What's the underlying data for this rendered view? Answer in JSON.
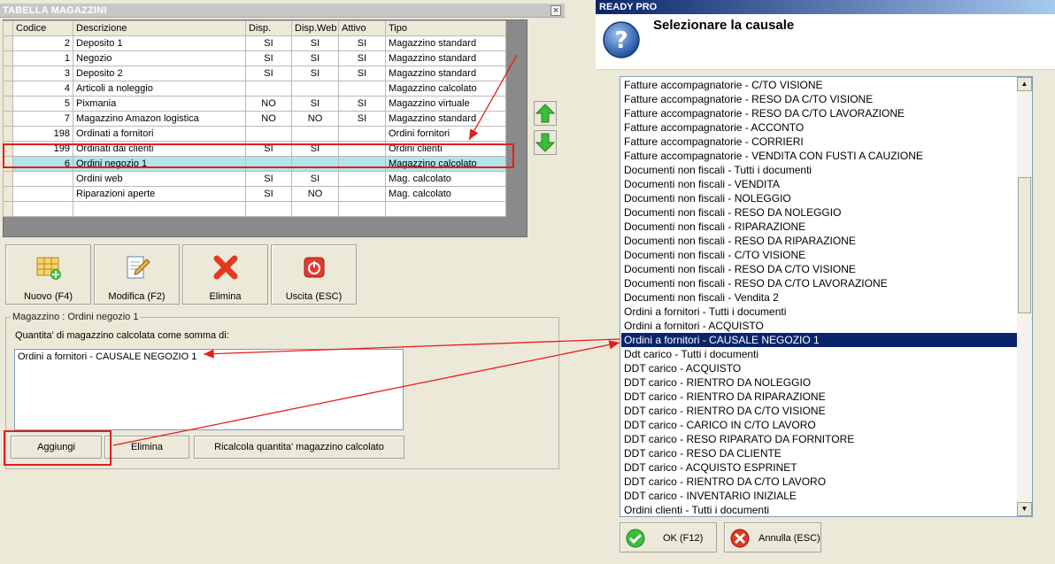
{
  "left_window": {
    "title": "TABELLA MAGAZZINI",
    "close_glyph": "×",
    "columns": [
      "Codice",
      "Descrizione",
      "Disp.",
      "Disp.Web",
      "Attivo",
      "Tipo"
    ],
    "rows": [
      {
        "codice": "2",
        "descrizione": "Deposito 1",
        "disp": "SI",
        "disp_web": "SI",
        "attivo": "SI",
        "tipo": "Magazzino standard"
      },
      {
        "codice": "1",
        "descrizione": "Negozio",
        "disp": "SI",
        "disp_web": "SI",
        "attivo": "SI",
        "tipo": "Magazzino standard"
      },
      {
        "codice": "3",
        "descrizione": "Deposito 2",
        "disp": "SI",
        "disp_web": "SI",
        "attivo": "SI",
        "tipo": "Magazzino standard"
      },
      {
        "codice": "4",
        "descrizione": "Articoli a noleggio",
        "disp": "",
        "disp_web": "",
        "attivo": "",
        "tipo": "Magazzino calcolato"
      },
      {
        "codice": "5",
        "descrizione": "Pixmania",
        "disp": "NO",
        "disp_web": "SI",
        "attivo": "SI",
        "tipo": "Magazzino virtuale"
      },
      {
        "codice": "7",
        "descrizione": "Magazzino Amazon logistica",
        "disp": "NO",
        "disp_web": "NO",
        "attivo": "SI",
        "tipo": "Magazzino standard"
      },
      {
        "codice": "198",
        "descrizione": "Ordinati a fornitori",
        "disp": "",
        "disp_web": "",
        "attivo": "",
        "tipo": "Ordini fornitori"
      },
      {
        "codice": "199",
        "descrizione": "Ordinati dai clienti",
        "disp": "SI",
        "disp_web": "SI",
        "attivo": "",
        "tipo": "Ordini clienti"
      },
      {
        "codice": "6",
        "descrizione": "Ordini negozio 1",
        "disp": "",
        "disp_web": "",
        "attivo": "",
        "tipo": "Magazzino calcolato"
      },
      {
        "codice": "",
        "descrizione": "Ordini web",
        "disp": "SI",
        "disp_web": "SI",
        "attivo": "",
        "tipo": "Mag. calcolato"
      },
      {
        "codice": "",
        "descrizione": "Riparazioni aperte",
        "disp": "SI",
        "disp_web": "NO",
        "attivo": "",
        "tipo": "Mag. calcolato"
      },
      {
        "codice": "",
        "descrizione": "",
        "disp": "",
        "disp_web": "",
        "attivo": "",
        "tipo": ""
      }
    ],
    "highlighted_row_index": 8,
    "toolbar": {
      "new_label": "Nuovo (F4)",
      "edit_label": "Modifica (F2)",
      "delete_label": "Elimina",
      "exit_label": "Uscita (ESC)"
    },
    "group": {
      "title": "Magazzino : Ordini negozio 1",
      "sum_label": "Quantita' di magazzino calcolata come somma di:",
      "items": [
        "Ordini a fornitori - CAUSALE NEGOZIO 1"
      ],
      "add_label": "Aggiungi",
      "remove_label": "Elimina",
      "recalc_label": "Ricalcola quantita' magazzino calcolato"
    }
  },
  "dialog": {
    "title": "READY PRO",
    "heading": "Selezionare la causale",
    "icon": "question-icon",
    "items": [
      "Fatture accompagnatorie - C/TO VISIONE",
      "Fatture accompagnatorie - RESO DA C/TO VISIONE",
      "Fatture accompagnatorie - RESO DA C/TO LAVORAZIONE",
      "Fatture accompagnatorie - ACCONTO",
      "Fatture accompagnatorie - CORRIERI",
      "Fatture accompagnatorie - VENDITA CON FUSTI A CAUZIONE",
      "Documenti non fiscali - Tutti i documenti",
      "Documenti non fiscali - VENDITA",
      "Documenti non fiscali - NOLEGGIO",
      "Documenti non fiscali - RESO DA NOLEGGIO",
      "Documenti non fiscali - RIPARAZIONE",
      "Documenti non fiscali - RESO DA RIPARAZIONE",
      "Documenti non fiscali - C/TO VISIONE",
      "Documenti non fiscali - RESO DA C/TO VISIONE",
      "Documenti non fiscali - RESO DA C/TO LAVORAZIONE",
      "Documenti non fiscali - Vendita 2",
      "Ordini a fornitori - Tutti i documenti",
      "Ordini a fornitori - ACQUISTO",
      "Ordini a fornitori - CAUSALE NEGOZIO 1",
      "Ddt carico - Tutti i documenti",
      "DDT carico - ACQUISTO",
      "DDT carico - RIENTRO DA NOLEGGIO",
      "DDT carico - RIENTRO DA RIPARAZIONE",
      "DDT carico - RIENTRO DA C/TO VISIONE",
      "DDT carico - CARICO IN C/TO LAVORO",
      "DDT carico - RESO RIPARATO DA FORNITORE",
      "DDT carico - RESO DA CLIENTE",
      "DDT carico - ACQUISTO ESPRINET",
      "DDT carico - RIENTRO DA C/TO LAVORO",
      "DDT carico - INVENTARIO INIZIALE",
      "Ordini clienti - Tutti i documenti"
    ],
    "selected_index": 18,
    "ok_label": "OK (F12)",
    "cancel_label": "Annulla (ESC)"
  },
  "colors": {
    "annotation_red": "#e41e1e",
    "selection_blue": "#0a246a",
    "row_highlight": "#b3e4e9"
  }
}
